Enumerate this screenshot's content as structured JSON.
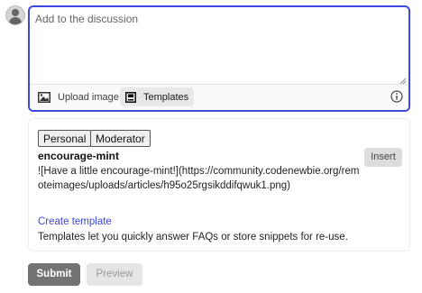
{
  "composer": {
    "placeholder": "Add to the discussion",
    "toolbar": {
      "upload_label": "Upload image",
      "templates_label": "Templates"
    }
  },
  "templates_panel": {
    "tabs": [
      "Personal",
      "Moderator"
    ],
    "active_tab": "Personal",
    "template": {
      "title": "encourage-mint",
      "body": "![Have a little encourage-mint!](https://community.codenewbie.org/remoteimages/uploads/articles/h95o25rgsikddifqwuk1.png)"
    },
    "insert_label": "Insert",
    "create_link": "Create template",
    "help_text": "Templates let you quickly answer FAQs or store snippets for re-use."
  },
  "actions": {
    "submit_label": "Submit",
    "preview_label": "Preview"
  },
  "colors": {
    "accent": "#3b49df",
    "submit_bg": "#737373"
  }
}
